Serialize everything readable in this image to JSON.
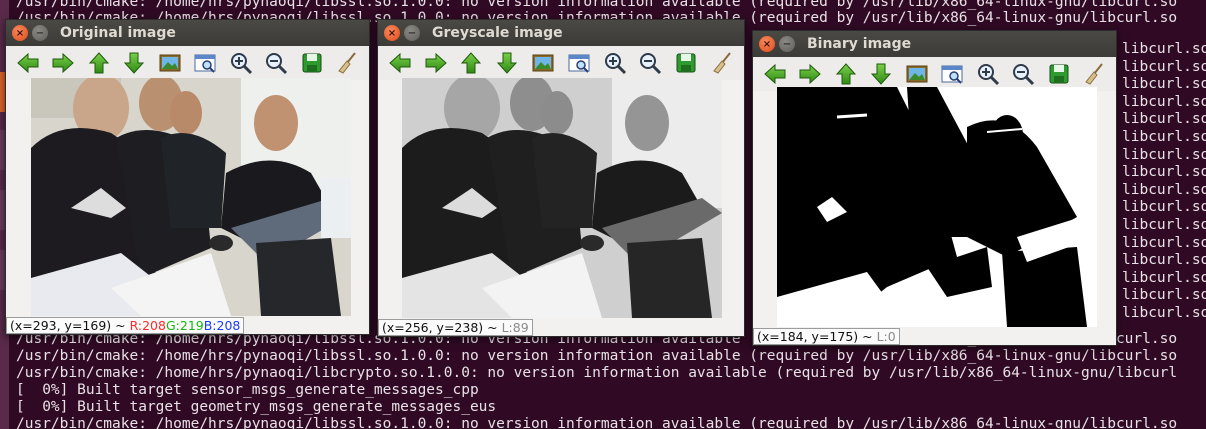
{
  "terminal": {
    "lines": [
      "/usr/bin/cmake: /home/hrs/pynaoqi/libssl.so.1.0.0: no version information available (required by /usr/lib/x86_64-linux-gnu/libcurl.so",
      "/usr/bin/cmake: /home/hrs/pynaoqi/libssl.so.1.0.0: no version information available (required by /usr/lib/x86_64-linux-gnu/libcurl.so",
      "/usr/bin/cmake: /home/hrs/pynaoqi/libssl.so.1.0.0: no version information available (required by /usr/lib/x86_64-linux-gnu/libcurl.so",
      "/usr/bin/cmake: /home/hrs/pynaoqi/libcrypto.so.1.0.0: no version information available (required by /usr/lib/x86_64-linux-gnu/libcurl",
      "[  0%] Built target sensor_msgs_generate_messages_cpp",
      "[  0%] Built target geometry_msgs_generate_messages_eus",
      "/usr/bin/cmake: /home/hrs/pynaoqi/libssl.so.1.0.0: no version information available (required by /usr/lib/x86_64-linux-gnu/libcurl.so"
    ],
    "right_fragments": [
      "libcurl.so",
      "libcurl.so",
      "libcurl.so",
      "libcurl.so",
      "libcurl.so",
      "libcurl.so",
      "libcurl.so",
      "libcurl.so",
      "libcurl.so",
      "libcurl.so",
      "libcurl.so",
      "libcurl.so",
      "libcurl.so",
      "libcurl.so",
      "libcurl.so",
      "libcurl.so"
    ],
    "colors": {
      "background": "#300a24",
      "text": "#e8e1e6"
    }
  },
  "windows": {
    "original": {
      "title": "Original image",
      "status": {
        "coords": "(x=293, y=169) ~ ",
        "r": "R:208",
        "g": "G:219",
        "b": "B:208"
      }
    },
    "greyscale": {
      "title": "Greyscale image",
      "status": {
        "coords": "(x=256, y=238) ~ ",
        "l": "L:89"
      }
    },
    "binary": {
      "title": "Binary image",
      "status": {
        "coords": "(x=184, y=175) ~ ",
        "l": "L:0"
      }
    }
  },
  "toolbar_icons": [
    "arrow-left-icon",
    "arrow-right-icon",
    "arrow-up-icon",
    "arrow-down-icon",
    "image-icon",
    "zoom-window-icon",
    "zoom-in-icon",
    "zoom-out-icon",
    "save-icon",
    "broom-icon"
  ],
  "colors": {
    "arrow_green": "#3a9a1c",
    "close_orange": "#df4a16"
  }
}
